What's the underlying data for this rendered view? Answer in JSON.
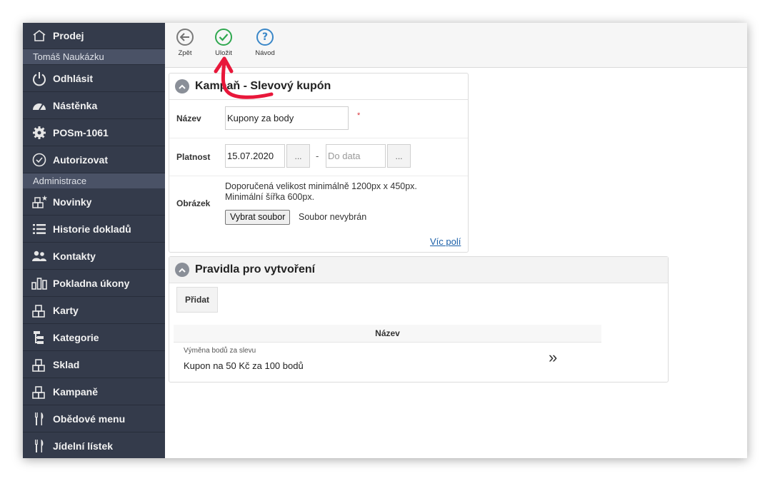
{
  "sidebar": {
    "top_item": {
      "label": "Prodej",
      "icon": "home-icon"
    },
    "user_name": "Tomáš Naukázku",
    "items_user": [
      {
        "label": "Odhlásit",
        "icon": "power-icon"
      },
      {
        "label": "Nástěnka",
        "icon": "dashboard-icon"
      },
      {
        "label": "POSm-1061",
        "icon": "gear-icon"
      },
      {
        "label": "Autorizovat",
        "icon": "check-circle-icon"
      }
    ],
    "section_label": "Administrace",
    "items_admin": [
      {
        "label": "Novinky",
        "icon": "boxes-star-icon"
      },
      {
        "label": "Historie dokladů",
        "icon": "list-icon"
      },
      {
        "label": "Kontakty",
        "icon": "users-icon"
      },
      {
        "label": "Pokladna úkony",
        "icon": "bars-icon"
      },
      {
        "label": "Karty",
        "icon": "boxes-icon"
      },
      {
        "label": "Kategorie",
        "icon": "tree-icon"
      },
      {
        "label": "Sklad",
        "icon": "boxes-icon"
      },
      {
        "label": "Kampaně",
        "icon": "boxes-icon"
      },
      {
        "label": "Obědové menu",
        "icon": "cutlery-icon"
      },
      {
        "label": "Jídelní lístek",
        "icon": "cutlery-icon"
      }
    ]
  },
  "toolbar": {
    "back_label": "Zpět",
    "save_label": "Uložit",
    "help_label": "Návod"
  },
  "campaign_panel": {
    "title": "Kampaň - Slevový kupón",
    "name_label": "Název",
    "name_value": "Kupony za body",
    "required_mark": "*",
    "validity_label": "Platnost",
    "date_from": "15.07.2020",
    "date_picker_label": "...",
    "date_separator": "-",
    "date_to_placeholder": "Do data",
    "image_label": "Obrázek",
    "image_hint_1": "Doporučená velikost minimálně 1200px x 450px.",
    "image_hint_2": "Minimální šířka 600px.",
    "file_button": "Vybrat soubor",
    "file_status": "Soubor nevybrán",
    "more_fields_link": "Víc polí"
  },
  "rules_panel": {
    "title": "Pravidla pro vytvoření",
    "add_button": "Přidat",
    "table_header": "Název",
    "rows": [
      {
        "subtitle": "Výměna bodů za slevu",
        "name": "Kupon na 50 Kč za 100 bodů",
        "action": "»"
      }
    ]
  },
  "colors": {
    "sidebar_bg": "#343b4b",
    "save_green": "#2fa84f",
    "help_blue": "#3a87c8",
    "annotation_arrow": "#e8173a"
  }
}
